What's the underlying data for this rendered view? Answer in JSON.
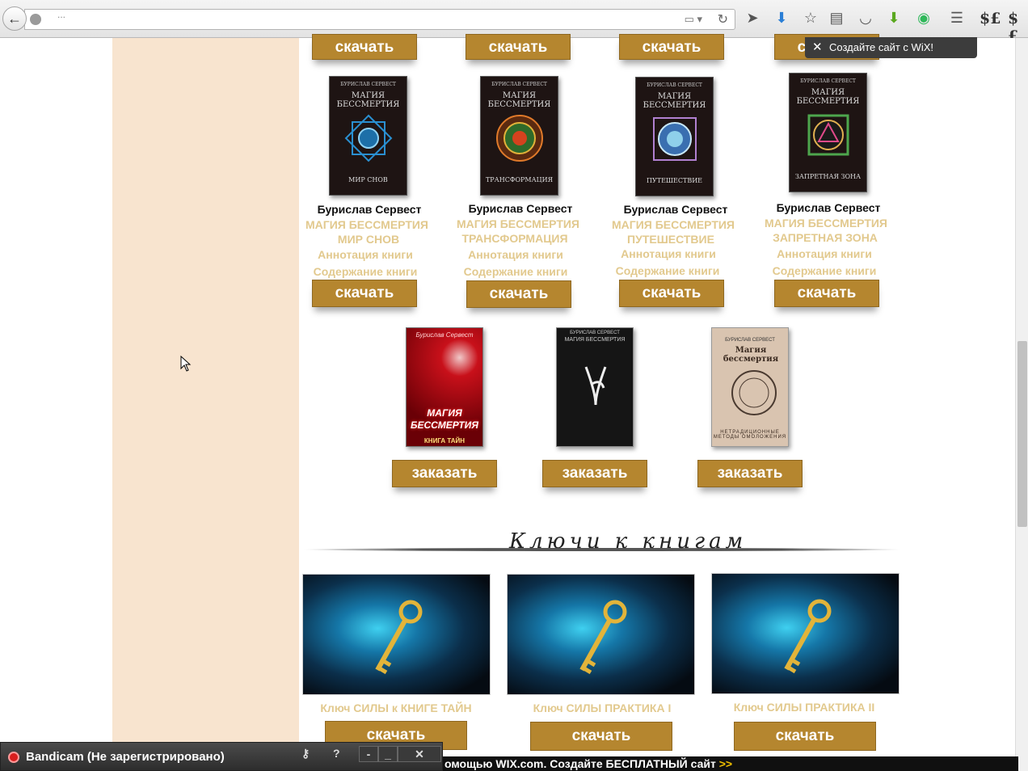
{
  "browser": {
    "url": "...",
    "dollar1": "$£",
    "dollar2": "$£"
  },
  "top_buttons": [
    "скачать",
    "скачать",
    "скачать",
    "скачать"
  ],
  "row1_books": [
    {
      "author": "Бурислав Сервест",
      "title1": "МАГИЯ БЕССМЕРТИЯ",
      "title2": "МИР СНОВ",
      "annotation": "Аннотация книги",
      "contents": "Содержание книги",
      "button": "скачать",
      "cover_author": "БУРИСЛАВ СЕРВЕСТ",
      "cover_title": "МАГИЯ БЕССМЕРТИЯ",
      "cover_sub": "МИР СНОВ",
      "accent": "#2a8fd0"
    },
    {
      "author": "Бурислав Сервест",
      "title1": "МАГИЯ БЕССМЕРТИЯ",
      "title2": "ТРАНСФОРМАЦИЯ",
      "annotation": "Аннотация книги",
      "contents": "Содержание книги",
      "button": "скачать",
      "cover_author": "БУРИСЛАВ СЕРВЕСТ",
      "cover_title": "МАГИЯ БЕССМЕРТИЯ",
      "cover_sub": "ТРАНСФОРМАЦИЯ",
      "accent": "#d4421e"
    },
    {
      "author": "Бурислав Сервест",
      "title1": "МАГИЯ БЕССМЕРТИЯ",
      "title2": "ПУТЕШЕСТВИЕ",
      "annotation": "Аннотация книги",
      "contents": "Содержание книги",
      "button": "скачать",
      "cover_author": "БУРИСЛАВ СЕРВЕСТ",
      "cover_title": "МАГИЯ БЕССМЕРТИЯ",
      "cover_sub": "ПУТЕШЕСТВИЕ",
      "accent": "#8fd0ea"
    },
    {
      "author": "Бурислав Сервест",
      "title1": "МАГИЯ БЕССМЕРТИЯ",
      "title2": "ЗАПРЕТНАЯ ЗОНА",
      "annotation": "Аннотация книги",
      "contents": "Содержание книги",
      "button": "скачать",
      "cover_author": "БУРИСЛАВ СЕРВЕСТ",
      "cover_title": "МАГИЯ БЕССМЕРТИЯ",
      "cover_sub": "ЗАПРЕТНАЯ ЗОНА",
      "accent": "#4da64d"
    }
  ],
  "order_books": [
    {
      "button": "заказать",
      "cover_author": "Бурислав Сервест",
      "cover_title": "МАГИЯ БЕССМЕРТИЯ",
      "cover_sub": "КНИГА ТАЙН"
    },
    {
      "button": "заказать",
      "cover_author": "БУРИСЛАВ СЕРВЕСТ",
      "cover_title": "МАГИЯ БЕССМЕРТИЯ",
      "cover_sub": ""
    },
    {
      "button": "заказать",
      "cover_author": "БУРИСЛАВ СЕРВЕСТ",
      "cover_title": "Магия бессмертия",
      "cover_sub": "НЕТРАДИЦИОННЫЕ МЕТОДЫ ОМОЛОЖЕНИЯ"
    }
  ],
  "keys_section": {
    "title": "Ключи к книгам",
    "items": [
      {
        "caption": "Ключ СИЛЫ к КНИГЕ ТАЙН",
        "button": "скачать"
      },
      {
        "caption": "Ключ СИЛЫ ПРАКТИКА I",
        "button": "скачать"
      },
      {
        "caption": "Ключ СИЛЫ ПРАКТИКА II",
        "button": "скачать"
      }
    ]
  },
  "wix_popup": "Создайте сайт с WiX!",
  "wix_footer": {
    "text": "омощью WIX.com. Создайте БЕСПЛАТНЫЙ сайт",
    "arrows": ">>"
  },
  "bandicam": {
    "title": "Bandicam (Не зарегистрировано)",
    "help": "?",
    "minimize": "_",
    "close": "✕",
    "dash": "-"
  },
  "colors": {
    "sidebar": "#f8e4cf",
    "button": "#b5862f",
    "gold_text": "#e2c98e"
  }
}
